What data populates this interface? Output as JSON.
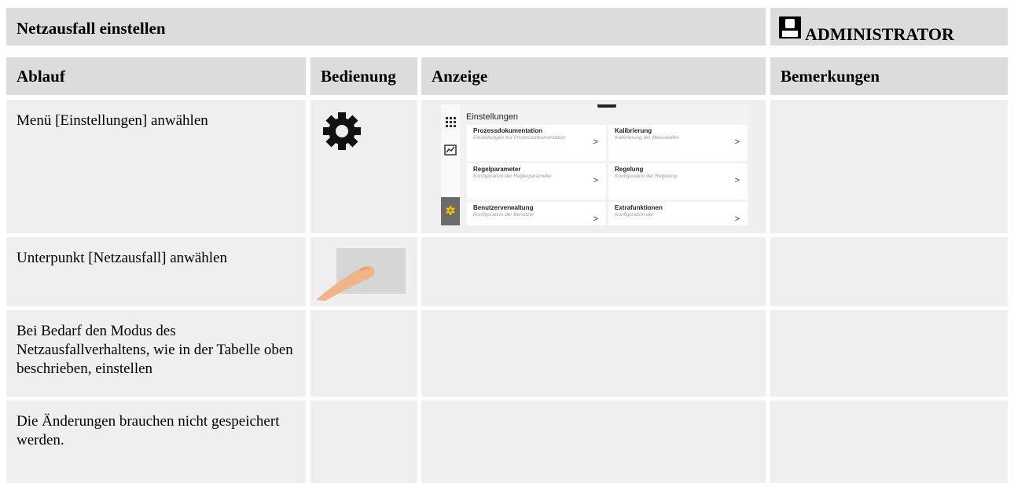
{
  "header": {
    "title": "Netzausfall einstellen",
    "role": "ADMINISTRATOR",
    "role_icon": "user-icon"
  },
  "columns": [
    "Ablauf",
    "Bedienung",
    "Anzeige",
    "Bemerkungen"
  ],
  "rows": [
    {
      "ablauf": "Menü [Einstellungen] anwählen",
      "bedienung_icon": "gear-icon"
    },
    {
      "ablauf": "Unterpunkt [Netzausfall] anwählen",
      "bedienung_icon": "touch-finger-icon"
    },
    {
      "ablauf": "Bei Bedarf den Modus des Netzausfallverhaltens, wie in der Tabelle oben beschrieben, einstellen"
    },
    {
      "ablauf": "Die Änderungen brauchen nicht gespeichert werden."
    }
  ],
  "screen": {
    "heading": "Einstellungen",
    "sidebar_icons": [
      "grid-icon",
      "chart-icon",
      "gear-icon"
    ],
    "tiles": [
      {
        "title": "Prozessdokumentation",
        "desc": "Einstellungen zur Prozessdokumentation"
      },
      {
        "title": "Kalibrierung",
        "desc": "Kalibrierung der Messstellen"
      },
      {
        "title": "Regelparameter",
        "desc": "Konfiguration der Reglerparameter"
      },
      {
        "title": "Regelung",
        "desc": "Konfiguration der Regelung"
      },
      {
        "title": "Benutzerverwaltung",
        "desc": "Konfiguration der Benutzer"
      },
      {
        "title": "Extrafunktionen",
        "desc": "Konfiguration der"
      }
    ],
    "chevron": ">"
  },
  "colors": {
    "header_bg": "#dcdcdc",
    "cell_bg": "#efefef",
    "active_tab": "#6b6b6b",
    "active_icon": "#f2c200",
    "finger": "#f0b48a"
  }
}
